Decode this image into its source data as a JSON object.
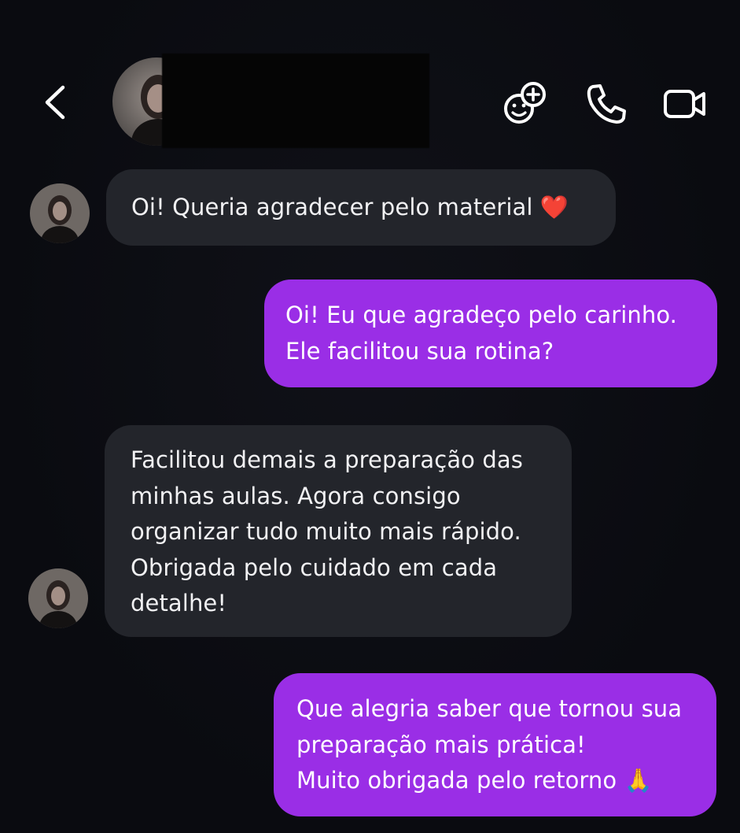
{
  "header": {
    "contact_name": "",
    "back_icon": "chevron-left-icon",
    "actions": [
      {
        "name": "add-effect-button",
        "icon": "face-plus-icon"
      },
      {
        "name": "call-button",
        "icon": "phone-icon"
      },
      {
        "name": "video-call-button",
        "icon": "video-camera-icon"
      }
    ]
  },
  "colors": {
    "background": "#0b0c11",
    "incoming_bubble": "#23252b",
    "outgoing_bubble": "#9a2ee6",
    "text": "#f2f2f4"
  },
  "messages": [
    {
      "direction": "incoming",
      "lines": [
        "Oi! Queria agradecer pelo material ❤️"
      ]
    },
    {
      "direction": "outgoing",
      "lines": [
        "Oi! Eu que agradeço pelo carinho.",
        "Ele facilitou sua rotina?"
      ]
    },
    {
      "direction": "incoming",
      "lines": [
        "Facilitou demais a preparação das",
        "minhas aulas. Agora consigo",
        "organizar tudo muito mais rápido.",
        "Obrigada pelo cuidado em cada",
        "detalhe!"
      ]
    },
    {
      "direction": "outgoing",
      "lines": [
        "Que alegria saber que tornou sua",
        "preparação mais prática!",
        "Muito obrigada pelo retorno 🙏"
      ]
    }
  ]
}
